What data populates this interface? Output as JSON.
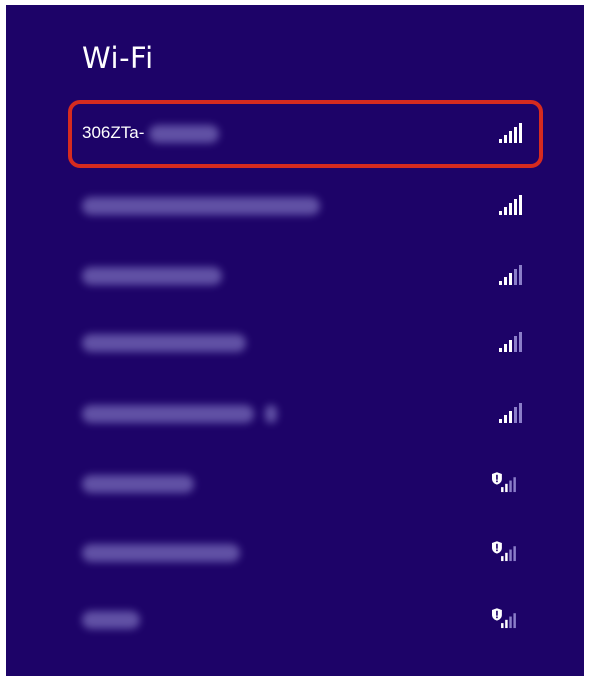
{
  "panel": {
    "title": "Wi-Fi",
    "background": "#1d0368",
    "highlight_color": "#d62b1f"
  },
  "networks": [
    {
      "name": "306ZTa-",
      "name_obscured": true,
      "signal_bars": 5,
      "secured_warning": false,
      "selected": true
    },
    {
      "name": "",
      "name_obscured": true,
      "signal_bars": 5,
      "secured_warning": false,
      "selected": false
    },
    {
      "name": "",
      "name_obscured": true,
      "signal_bars": 3,
      "secured_warning": false,
      "selected": false
    },
    {
      "name": "",
      "name_obscured": true,
      "signal_bars": 3,
      "secured_warning": false,
      "selected": false
    },
    {
      "name": "",
      "name_obscured": true,
      "signal_bars": 3,
      "secured_warning": false,
      "selected": false
    },
    {
      "name": "",
      "name_obscured": true,
      "signal_bars": 3,
      "secured_warning": true,
      "selected": false
    },
    {
      "name": "",
      "name_obscured": true,
      "signal_bars": 3,
      "secured_warning": true,
      "selected": false
    },
    {
      "name": "",
      "name_obscured": true,
      "signal_bars": 3,
      "secured_warning": true,
      "selected": false
    }
  ]
}
